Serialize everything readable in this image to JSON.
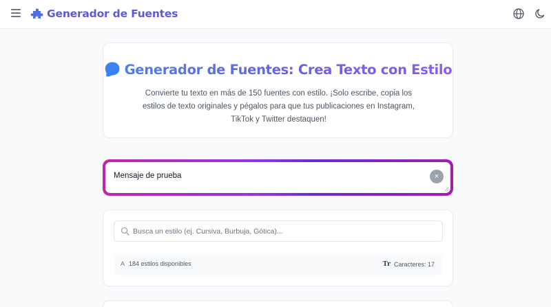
{
  "header": {
    "brand": "Generador de Fuentes",
    "icons": {
      "menu": "hamburger-icon",
      "logo": "puzzle-icon",
      "language": "globe-icon",
      "theme": "moon-icon"
    },
    "brand_color": "#5b5bd6"
  },
  "hero": {
    "title": "Generador de Fuentes: Crea Texto con Estilo",
    "description": "Convierte tu texto en más de 150 fuentes con estilo. ¡Solo escribe, copia los estilos de texto originales y pégalos para que tus publicaciones en Instagram, TikTok y Twitter destaquen!",
    "icon": "blob-icon"
  },
  "input": {
    "value": "Mensaje de prueba",
    "clear_label": "×",
    "border_gradient": [
      "#c026a8",
      "#9333ea",
      "#6d28d9",
      "#a21caf"
    ]
  },
  "search": {
    "placeholder": "Busca un estilo (ej. Cursiva, Burbuja, Gótica)...",
    "styles_count": "184 estilos disponibles",
    "styles_glyph": "A",
    "chars_glyph": "Tr",
    "chars_label": "Caracteres: 17"
  }
}
